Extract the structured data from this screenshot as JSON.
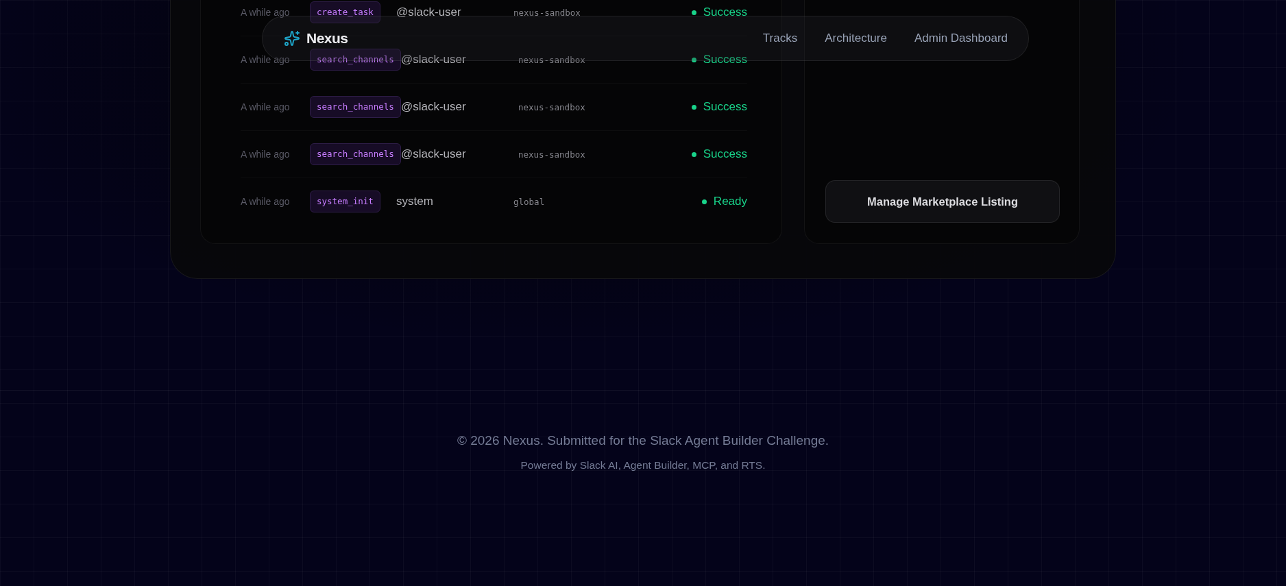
{
  "nav": {
    "brand": "Nexus",
    "links": [
      "Tracks",
      "Architecture",
      "Admin Dashboard"
    ]
  },
  "activity": {
    "rows": [
      {
        "time": "A while ago",
        "tool": "create_task",
        "user": "@slack-user",
        "channel": "nexus-sandbox",
        "status": "Success"
      },
      {
        "time": "A while ago",
        "tool": "search_channels",
        "user": "@slack-user",
        "channel": "nexus-sandbox",
        "status": "Success"
      },
      {
        "time": "A while ago",
        "tool": "search_channels",
        "user": "@slack-user",
        "channel": "nexus-sandbox",
        "status": "Success"
      },
      {
        "time": "A while ago",
        "tool": "search_channels",
        "user": "@slack-user",
        "channel": "nexus-sandbox",
        "status": "Success"
      },
      {
        "time": "A while ago",
        "tool": "system_init",
        "user": "system",
        "channel": "global",
        "status": "Ready"
      }
    ]
  },
  "marketplace": {
    "button": "Manage Marketplace Listing"
  },
  "footer": {
    "copyright": "© 2026 Nexus. Submitted for the Slack Agent Builder Challenge.",
    "powered": "Powered by Slack AI, Agent Builder, MCP, and RTS."
  }
}
